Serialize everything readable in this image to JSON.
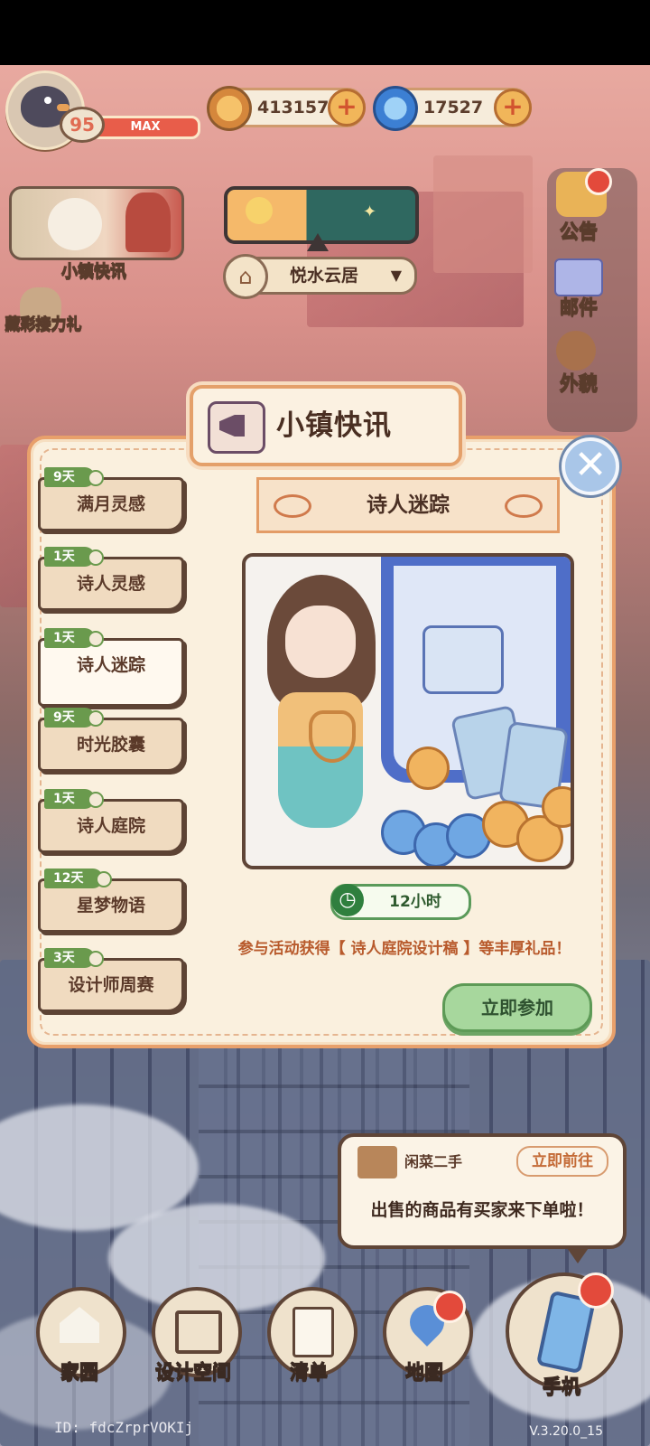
{
  "hud": {
    "level": "95",
    "level_state": "MAX",
    "coins": "413157",
    "gems": "17527",
    "plus": "+"
  },
  "left_menu": {
    "town_news": "小镇快讯",
    "collection_relay": "藏彩接力礼"
  },
  "location": {
    "name": "悦水云居"
  },
  "side_menu": {
    "notice": "公告",
    "mail": "邮件",
    "appearance": "外貌"
  },
  "modal": {
    "title": "小镇快讯",
    "close": "✕",
    "tabs": [
      {
        "days": "9天",
        "label": "满月灵感"
      },
      {
        "days": "1天",
        "label": "诗人灵感"
      },
      {
        "days": "1天",
        "label": "诗人迷踪"
      },
      {
        "days": "9天",
        "label": "时光胶囊"
      },
      {
        "days": "1天",
        "label": "诗人庭院"
      },
      {
        "days": "12天",
        "label": "星梦物语"
      },
      {
        "days": "3天",
        "label": "设计师周赛"
      }
    ],
    "active_tab": 2,
    "event": {
      "title": "诗人迷踪",
      "timer": "12小时",
      "description": "参与活动获得【 诗人庭院设计稿 】等丰厚礼品！",
      "join_button": "立即参加"
    }
  },
  "notification": {
    "source": "闲菜二手",
    "action": "立即前往",
    "message": "出售的商品有买家来下单啦！"
  },
  "bottom_nav": {
    "home": "家园",
    "design_space": "设计空间",
    "list": "清单",
    "map": "地图",
    "phone": "手机"
  },
  "footer": {
    "id": "ID: fdcZrprVOKIj",
    "version": "V.3.20.0_15"
  },
  "colors": {
    "accent_green": "#6a9a4d",
    "badge_red": "#e34a3b",
    "frame_orange": "#e8a06b"
  }
}
